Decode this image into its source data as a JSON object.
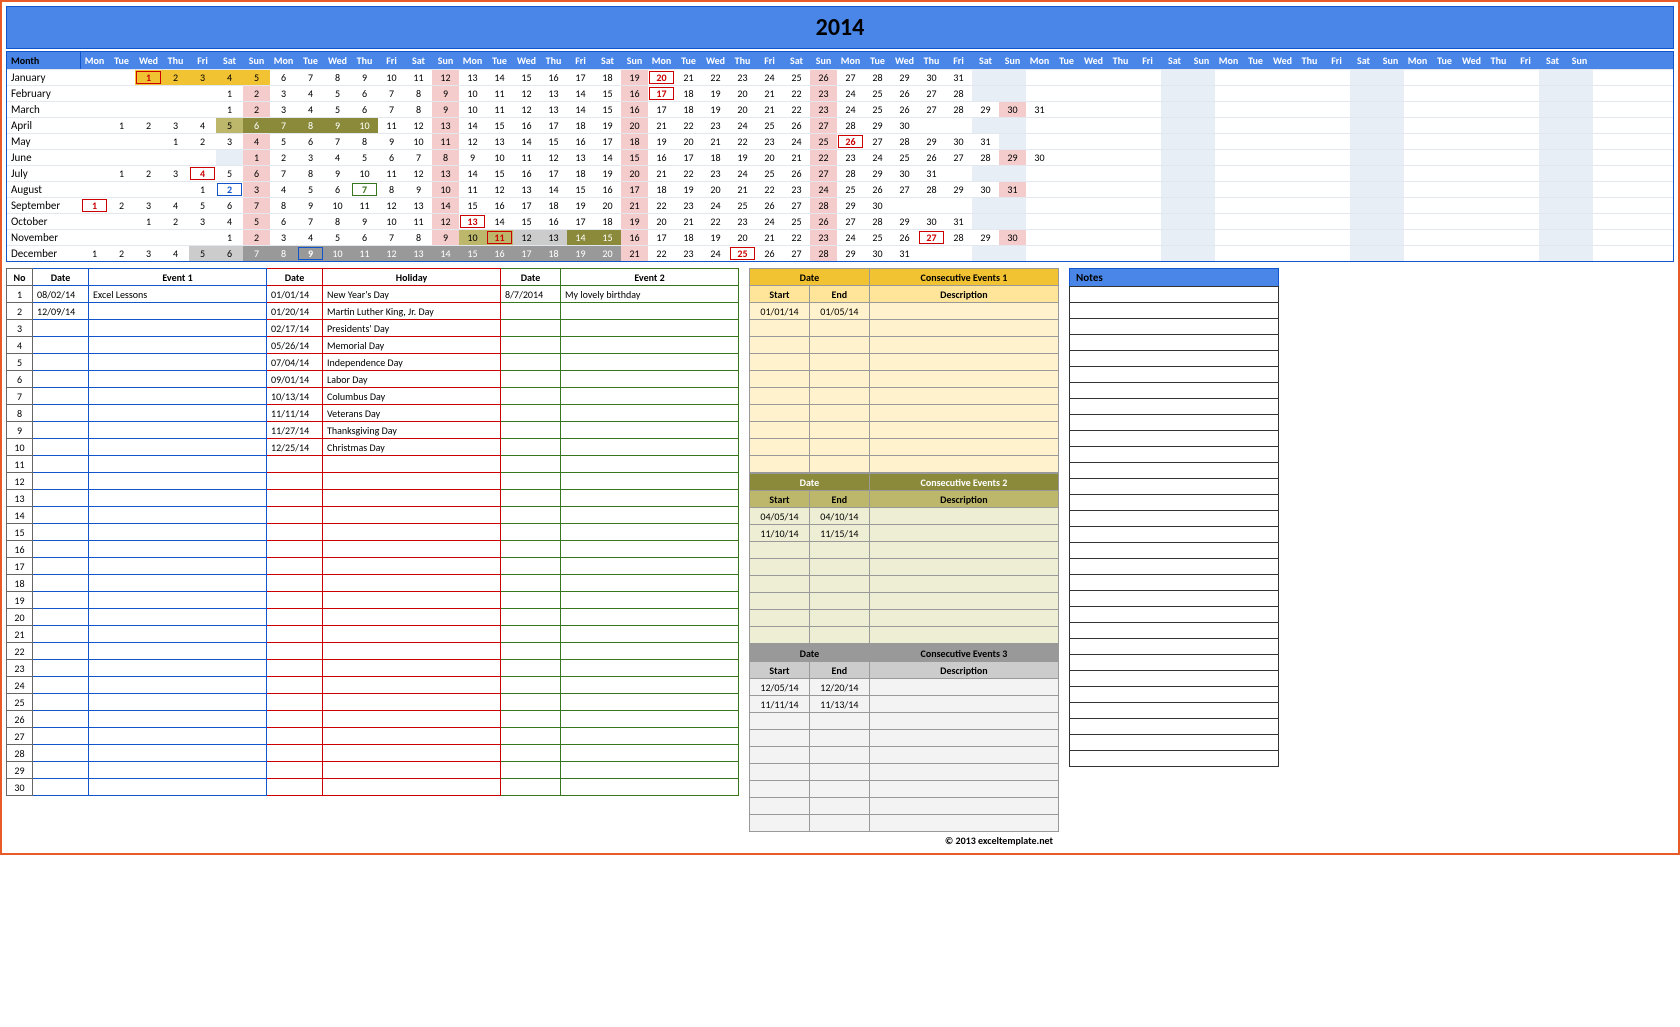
{
  "title": "2014",
  "header": {
    "month_label": "Month"
  },
  "dow": [
    "Mon",
    "Tue",
    "Wed",
    "Thu",
    "Fri",
    "Sat",
    "Sun"
  ],
  "dow_repeat": 8,
  "months": [
    {
      "name": "January",
      "offset": 2,
      "days": 31,
      "styles": {
        "1": "redbox orange",
        "2": "orange",
        "3": "orange",
        "4": "orange",
        "5": "orange",
        "20": "redbox",
        "12": "sun",
        "19": "sun",
        "26": "sun"
      }
    },
    {
      "name": "February",
      "offset": 5,
      "days": 28,
      "styles": {
        "2": "sun",
        "9": "sun",
        "16": "sun",
        "17": "redbox",
        "23": "sun"
      }
    },
    {
      "name": "March",
      "offset": 5,
      "days": 31,
      "styles": {
        "2": "sun",
        "9": "sun",
        "16": "sun",
        "23": "sun",
        "30": "sun"
      }
    },
    {
      "name": "April",
      "offset": 1,
      "days": 30,
      "styles": {
        "5": "olive-lt",
        "6": "olive",
        "7": "olive",
        "8": "olive",
        "9": "olive",
        "10": "olive",
        "13": "sun",
        "20": "sun",
        "27": "sun"
      }
    },
    {
      "name": "May",
      "offset": 3,
      "days": 31,
      "styles": {
        "4": "sun",
        "11": "sun",
        "18": "sun",
        "25": "sun",
        "26": "redbox"
      }
    },
    {
      "name": "June",
      "offset": 6,
      "days": 30,
      "styles": {
        "1": "sun",
        "8": "sun",
        "15": "sun",
        "22": "sun",
        "29": "sun"
      }
    },
    {
      "name": "July",
      "offset": 1,
      "days": 31,
      "styles": {
        "4": "redbox",
        "6": "sun",
        "13": "sun",
        "20": "sun",
        "27": "sun"
      }
    },
    {
      "name": "August",
      "offset": 4,
      "days": 31,
      "styles": {
        "2": "bluebox",
        "3": "sun",
        "7": "greenbox",
        "10": "sun",
        "17": "sun",
        "24": "sun",
        "31": "sun"
      }
    },
    {
      "name": "September",
      "offset": 0,
      "days": 30,
      "styles": {
        "1": "redbox",
        "7": "sun",
        "14": "sun",
        "21": "sun",
        "28": "sun"
      }
    },
    {
      "name": "October",
      "offset": 2,
      "days": 31,
      "styles": {
        "5": "sun",
        "12": "sun",
        "13": "redbox",
        "19": "sun",
        "26": "sun"
      }
    },
    {
      "name": "November",
      "offset": 5,
      "days": 30,
      "styles": {
        "2": "sun",
        "9": "sun",
        "10": "olive-lt",
        "11": "redbox olive-lt",
        "12": "olive-lt gray-lt",
        "13": "olive-lt gray-lt",
        "14": "olive",
        "15": "olive",
        "16": "sun",
        "23": "sun",
        "27": "redbox",
        "30": "sun"
      }
    },
    {
      "name": "December",
      "offset": 0,
      "days": 31,
      "styles": {
        "5": "gray-lt",
        "6": "gray-lt",
        "7": "gray sun",
        "8": "gray",
        "9": "bluebox gray",
        "10": "gray",
        "11": "gray",
        "12": "gray",
        "13": "gray",
        "14": "gray sun",
        "15": "gray",
        "16": "gray",
        "17": "gray",
        "18": "gray",
        "19": "gray",
        "20": "gray",
        "21": "sun",
        "25": "redbox",
        "28": "sun"
      }
    }
  ],
  "events_headers": [
    "No",
    "Date",
    "Event 1",
    "Date",
    "Holiday",
    "Date",
    "Event 2"
  ],
  "events_rows": [
    {
      "no": 1,
      "d1": "08/02/14",
      "e1": "Excel Lessons",
      "d2": "01/01/14",
      "hol": "New Year's Day",
      "d3": "8/7/2014",
      "e2": "My lovely birthday"
    },
    {
      "no": 2,
      "d1": "12/09/14",
      "e1": "",
      "d2": "01/20/14",
      "hol": "Martin Luther King, Jr. Day",
      "d3": "",
      "e2": ""
    },
    {
      "no": 3,
      "d1": "",
      "e1": "",
      "d2": "02/17/14",
      "hol": "Presidents' Day",
      "d3": "",
      "e2": ""
    },
    {
      "no": 4,
      "d1": "",
      "e1": "",
      "d2": "05/26/14",
      "hol": "Memorial Day",
      "d3": "",
      "e2": ""
    },
    {
      "no": 5,
      "d1": "",
      "e1": "",
      "d2": "07/04/14",
      "hol": "Independence Day",
      "d3": "",
      "e2": ""
    },
    {
      "no": 6,
      "d1": "",
      "e1": "",
      "d2": "09/01/14",
      "hol": "Labor Day",
      "d3": "",
      "e2": ""
    },
    {
      "no": 7,
      "d1": "",
      "e1": "",
      "d2": "10/13/14",
      "hol": "Columbus Day",
      "d3": "",
      "e2": ""
    },
    {
      "no": 8,
      "d1": "",
      "e1": "",
      "d2": "11/11/14",
      "hol": "Veterans Day",
      "d3": "",
      "e2": ""
    },
    {
      "no": 9,
      "d1": "",
      "e1": "",
      "d2": "11/27/14",
      "hol": "Thanksgiving Day",
      "d3": "",
      "e2": ""
    },
    {
      "no": 10,
      "d1": "",
      "e1": "",
      "d2": "12/25/14",
      "hol": "Christmas Day",
      "d3": "",
      "e2": ""
    },
    {
      "no": 11
    },
    {
      "no": 12
    },
    {
      "no": 13
    },
    {
      "no": 14
    },
    {
      "no": 15
    },
    {
      "no": 16
    },
    {
      "no": 17
    },
    {
      "no": 18
    },
    {
      "no": 19
    },
    {
      "no": 20
    },
    {
      "no": 21
    },
    {
      "no": 22
    },
    {
      "no": 23
    },
    {
      "no": 24
    },
    {
      "no": 25
    },
    {
      "no": 26
    },
    {
      "no": 27
    },
    {
      "no": 28
    },
    {
      "no": 29
    },
    {
      "no": 30
    }
  ],
  "consec": [
    {
      "title": "Consecutive Events 1",
      "date_label": "Date",
      "sub": [
        "Start",
        "End",
        "Description"
      ],
      "rows": [
        {
          "s": "01/01/14",
          "e": "01/05/14",
          "d": ""
        },
        {},
        {},
        {},
        {},
        {},
        {},
        {},
        {},
        {}
      ]
    },
    {
      "title": "Consecutive Events 2",
      "date_label": "Date",
      "sub": [
        "Start",
        "End",
        "Description"
      ],
      "rows": [
        {
          "s": "04/05/14",
          "e": "04/10/14",
          "d": ""
        },
        {
          "s": "11/10/14",
          "e": "11/15/14",
          "d": ""
        },
        {},
        {},
        {},
        {},
        {},
        {}
      ]
    },
    {
      "title": "Consecutive Events 3",
      "date_label": "Date",
      "sub": [
        "Start",
        "End",
        "Description"
      ],
      "rows": [
        {
          "s": "12/05/14",
          "e": "12/20/14",
          "d": ""
        },
        {
          "s": "11/11/14",
          "e": "11/13/14",
          "d": ""
        },
        {},
        {},
        {},
        {},
        {},
        {},
        {}
      ]
    }
  ],
  "notes": {
    "header": "Notes",
    "rows": 30
  },
  "copyright": "© 2013 exceltemplate.net"
}
